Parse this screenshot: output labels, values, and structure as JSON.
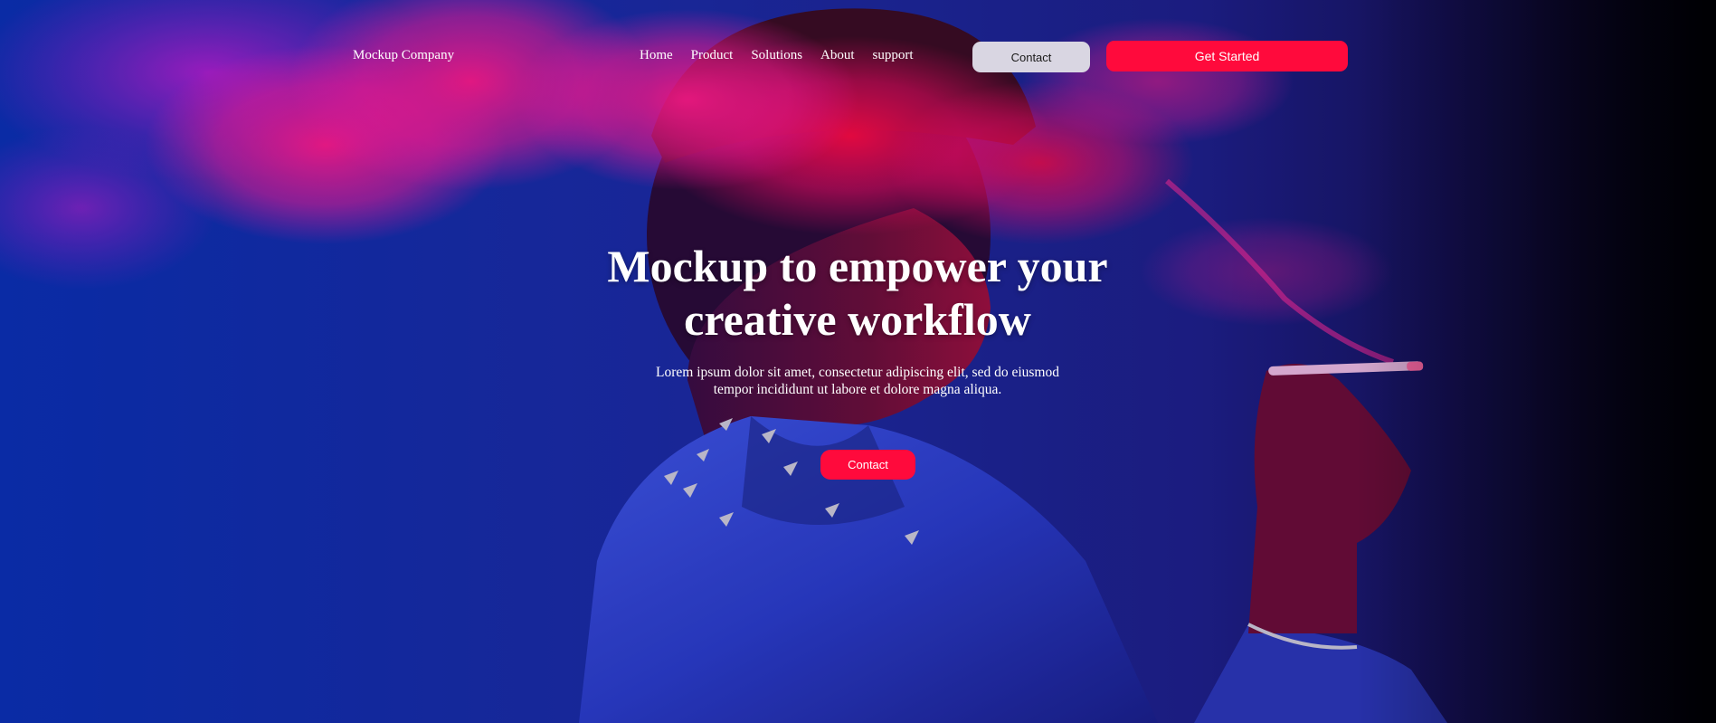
{
  "header": {
    "brand": "Mockup Company",
    "nav": [
      "Home",
      "Product",
      "Solutions",
      "About",
      "support"
    ],
    "contact_label": "Contact",
    "get_started_label": "Get Started"
  },
  "hero": {
    "headline_line1": "Mockup to empower your",
    "headline_line2": "creative workflow",
    "subtitle_line1": "Lorem ipsum dolor sit amet, consectetur adipiscing elit, sed do eiusmod",
    "subtitle_line2": "tempor incididunt ut labore et dolore magna aliqua.",
    "contact_label": "Contact",
    "background_image": "person-smoking-neon-smoke-photo"
  },
  "colors": {
    "accent": "#ff0a3c",
    "contact_button_bg": "#d9d6e2",
    "background_blue": "#1c2aa3",
    "smoke_pink": "#ff1a9a"
  }
}
